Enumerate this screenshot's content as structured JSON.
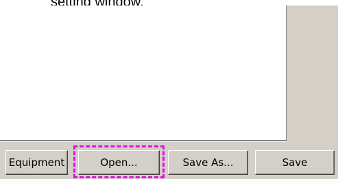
{
  "caption": "setting window.",
  "buttons": {
    "equipment": "Equipment",
    "open": "Open...",
    "save_as": "Save As...",
    "save": "Save"
  },
  "colors": {
    "dialog_face": "#d4d0c8",
    "highlight": "#e010e0"
  }
}
